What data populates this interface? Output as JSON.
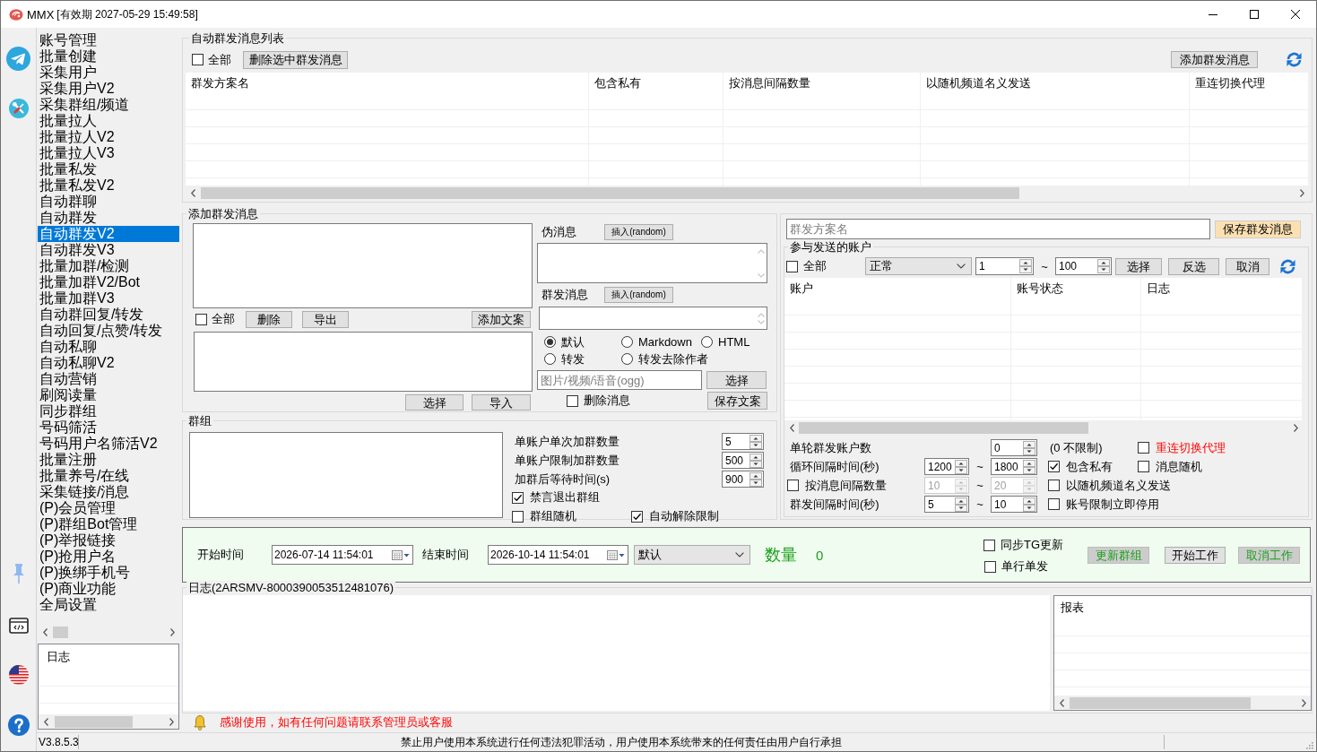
{
  "window": {
    "title": "MMX",
    "subtitle": "[有效期 2027-05-29 15:49:58]"
  },
  "sidebar": {
    "items": [
      {
        "label": "账号管理",
        "selected": false
      },
      {
        "label": "批量创建",
        "selected": false
      },
      {
        "label": "采集用户",
        "selected": false
      },
      {
        "label": "采集用户V2",
        "selected": false
      },
      {
        "label": "采集群组/频道",
        "selected": false
      },
      {
        "label": "批量拉人",
        "selected": false
      },
      {
        "label": "批量拉人V2",
        "selected": false
      },
      {
        "label": "批量拉人V3",
        "selected": false
      },
      {
        "label": "批量私发",
        "selected": false
      },
      {
        "label": "批量私发V2",
        "selected": false
      },
      {
        "label": "自动群聊",
        "selected": false
      },
      {
        "label": "自动群发",
        "selected": false
      },
      {
        "label": "自动群发V2",
        "selected": true
      },
      {
        "label": "自动群发V3",
        "selected": false
      },
      {
        "label": "批量加群/检测",
        "selected": false
      },
      {
        "label": "批量加群V2/Bot",
        "selected": false
      },
      {
        "label": "批量加群V3",
        "selected": false
      },
      {
        "label": "自动群回复/转发",
        "selected": false
      },
      {
        "label": "自动回复/点赞/转发",
        "selected": false
      },
      {
        "label": "自动私聊",
        "selected": false
      },
      {
        "label": "自动私聊V2",
        "selected": false
      },
      {
        "label": "自动营销",
        "selected": false
      },
      {
        "label": "刷阅读量",
        "selected": false
      },
      {
        "label": "同步群组",
        "selected": false
      },
      {
        "label": "号码筛活",
        "selected": false
      },
      {
        "label": "号码用户名筛活V2",
        "selected": false
      },
      {
        "label": "批量注册",
        "selected": false
      },
      {
        "label": "批量养号/在线",
        "selected": false
      },
      {
        "label": "采集链接/消息",
        "selected": false
      },
      {
        "label": "(P)会员管理",
        "selected": false
      },
      {
        "label": "(P)群组Bot管理",
        "selected": false
      },
      {
        "label": "(P)举报链接",
        "selected": false
      },
      {
        "label": "(P)抢用户名",
        "selected": false
      },
      {
        "label": "(P)换绑手机号",
        "selected": false
      },
      {
        "label": "(P)商业功能",
        "selected": false
      },
      {
        "label": "全局设置",
        "selected": false
      }
    ],
    "log_list": {
      "header": "日志"
    }
  },
  "message_list": {
    "title": "自动群发消息列表",
    "select_all": {
      "label": "全部",
      "checked": false
    },
    "delete_button": "删除选中群发消息",
    "add_button": "添加群发消息",
    "columns": [
      "群发方案名",
      "包含私有",
      "按消息间隔数量",
      "以随机频道名义发送",
      "重连切换代理"
    ]
  },
  "compose": {
    "title": "添加群发消息",
    "select_all": {
      "label": "全部",
      "checked": false
    },
    "list_buttons": [
      "删除",
      "导出"
    ],
    "add_copy_button": "添加文案",
    "file_buttons": [
      "选择",
      "导入"
    ],
    "fake_message": {
      "label": "伪消息",
      "insert_button": "插入(random)"
    },
    "broadcast_message": {
      "label": "群发消息",
      "insert_button": "插入(random)"
    },
    "formats": [
      {
        "label": "默认",
        "selected": true
      },
      {
        "label": "Markdown",
        "selected": false
      },
      {
        "label": "HTML",
        "selected": false
      },
      {
        "label": "转发",
        "selected": false
      },
      {
        "label": "转发去除作者",
        "selected": false
      }
    ],
    "media": {
      "placeholder": "图片/视频/语音(ogg)",
      "button": "选择"
    },
    "delete_message": {
      "label": "删除消息",
      "checked": false
    },
    "save_button": "保存文案"
  },
  "groups": {
    "title": "群组",
    "limits": [
      {
        "label": "单账户单次加群数量",
        "value": "5"
      },
      {
        "label": "单账户限制加群数量",
        "value": "500"
      },
      {
        "label": "加群后等待时间(s)",
        "value": "900"
      }
    ],
    "options": [
      {
        "label": "禁言退出群组",
        "checked": true
      },
      {
        "label": "群组随机",
        "checked": false
      },
      {
        "label": "自动解除限制",
        "checked": true
      }
    ]
  },
  "plan": {
    "name": {
      "placeholder": "群发方案名"
    },
    "save_button": "保存群发消息"
  },
  "accounts": {
    "title": "参与发送的账户",
    "select_all": {
      "label": "全部",
      "checked": false
    },
    "status_filter": "正常",
    "range": {
      "from": "1",
      "separator": "~",
      "to": "100"
    },
    "buttons": [
      "选择",
      "反选",
      "取消"
    ],
    "columns": [
      "账户",
      "账号状态",
      "日志"
    ]
  },
  "send_settings": [
    {
      "kind": "single",
      "label": "单轮群发账户数",
      "value": "0",
      "disabled": false,
      "note": "(0 不限制)",
      "options": [
        {
          "label": "重连切换代理",
          "checked": false,
          "highlighted": true
        }
      ]
    },
    {
      "kind": "range",
      "label": "循环间隔时间(秒)",
      "from": "1200",
      "separator": "~",
      "to": "1800",
      "disabled": false,
      "options": [
        {
          "label": "包含私有",
          "checked": true,
          "highlighted": false
        },
        {
          "label": "消息随机",
          "checked": false,
          "highlighted": false
        }
      ]
    },
    {
      "kind": "checked_range",
      "label": "按消息间隔数量",
      "checked": false,
      "from": "10",
      "separator": "~",
      "to": "20",
      "disabled": true,
      "options": [
        {
          "label": "以随机频道名义发送",
          "checked": false,
          "highlighted": false
        }
      ]
    },
    {
      "kind": "range",
      "label": "群发间隔时间(秒)",
      "from": "5",
      "separator": "~",
      "to": "10",
      "disabled": false,
      "options": [
        {
          "label": "账号限制立即停用",
          "checked": false,
          "highlighted": false
        }
      ]
    }
  ],
  "schedule": {
    "start": {
      "label": "开始时间",
      "value": "2026-07-14 11:54:01"
    },
    "end": {
      "label": "结束时间",
      "value": "2026-10-14 11:54:01"
    },
    "mode": "默认",
    "count": {
      "label": "数量",
      "value": "0"
    },
    "options": [
      {
        "label": "同步TG更新",
        "checked": false
      },
      {
        "label": "单行单发",
        "checked": false
      }
    ],
    "buttons": [
      {
        "label": "更新群组",
        "kind": "accent"
      },
      {
        "label": "开始工作",
        "kind": "normal"
      },
      {
        "label": "取消工作",
        "kind": "accent"
      }
    ]
  },
  "log": {
    "title": "日志(2ARSMV-8000390053512481076)",
    "report_header": "报表"
  },
  "notice": "感谢使用，如有任何问题请联系管理员或客服",
  "status_bar": {
    "version": "V3.8.5.3",
    "disclaimer": "禁止用户使用本系统进行任何违法犯罪活动，用户使用本系统带来的任何责任由用户自行承担"
  }
}
